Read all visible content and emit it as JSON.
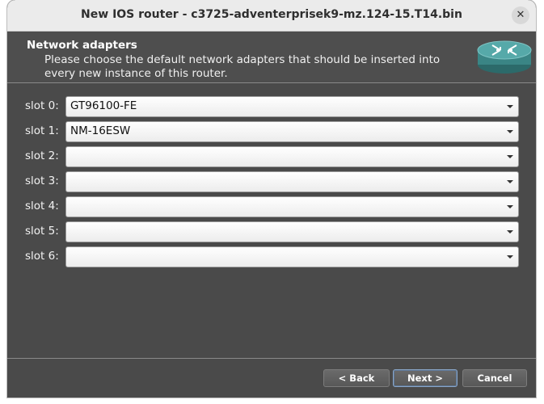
{
  "window": {
    "title": "New IOS router - c3725-adventerprisek9-mz.124-15.T14.bin",
    "close_icon": "close-icon"
  },
  "header": {
    "title": "Network adapters",
    "subtitle": "Please choose the default network adapters that should be inserted into every new instance of this router.",
    "icon": "router-icon"
  },
  "slots": [
    {
      "label": "slot 0:",
      "value": "GT96100-FE"
    },
    {
      "label": "slot 1:",
      "value": "NM-16ESW"
    },
    {
      "label": "slot 2:",
      "value": ""
    },
    {
      "label": "slot 3:",
      "value": ""
    },
    {
      "label": "slot 4:",
      "value": ""
    },
    {
      "label": "slot 5:",
      "value": ""
    },
    {
      "label": "slot 6:",
      "value": ""
    }
  ],
  "buttons": {
    "back": "< Back",
    "next": "Next >",
    "cancel": "Cancel"
  },
  "colors": {
    "dialog_bg": "#4a4a4a",
    "titlebar_bg": "#ebebeb",
    "router_icon": "#3f8f8f"
  }
}
